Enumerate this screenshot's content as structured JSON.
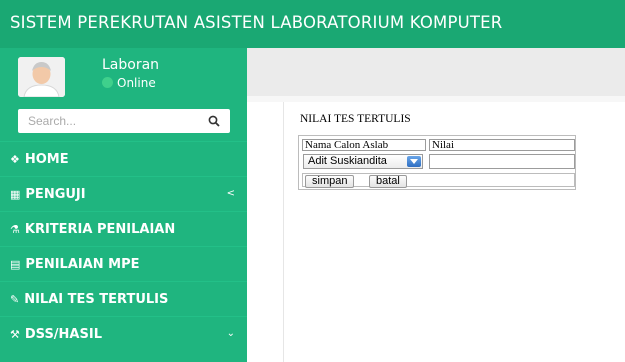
{
  "header": {
    "title": "SISTEM PEREKRUTAN ASISTEN LABORATORIUM KOMPUTER"
  },
  "user": {
    "name": "Laboran",
    "status": "Online"
  },
  "search": {
    "placeholder": "Search..."
  },
  "menu": {
    "items": [
      {
        "label": "HOME",
        "icon": "dashboard-icon",
        "glyph": "❖"
      },
      {
        "label": "PENGUJI",
        "icon": "table-icon",
        "glyph": "▦",
        "arrow": "<"
      },
      {
        "label": "KRITERIA PENILAIAN",
        "icon": "flask-icon",
        "glyph": "⚗"
      },
      {
        "label": "PENILAIAN MPE",
        "icon": "grid-icon",
        "glyph": "▤"
      },
      {
        "label": "NILAI TES TERTULIS",
        "icon": "edit-icon",
        "glyph": "✎"
      },
      {
        "label": "DSS/HASIL",
        "icon": "wrench-icon",
        "glyph": "⚒",
        "arrow": "⌄"
      }
    ]
  },
  "panel": {
    "title": "NILAI TES TERTULIS",
    "col_name": "Nama Calon Aslab",
    "col_value": "Nilai",
    "selected_candidate": "Adit Suskiandita",
    "nilai_value": "",
    "save_label": "simpan",
    "cancel_label": "batal"
  },
  "colors": {
    "topbar": "#1aa873",
    "sidebar": "#1fb57f",
    "content_header": "#ebebeb"
  }
}
